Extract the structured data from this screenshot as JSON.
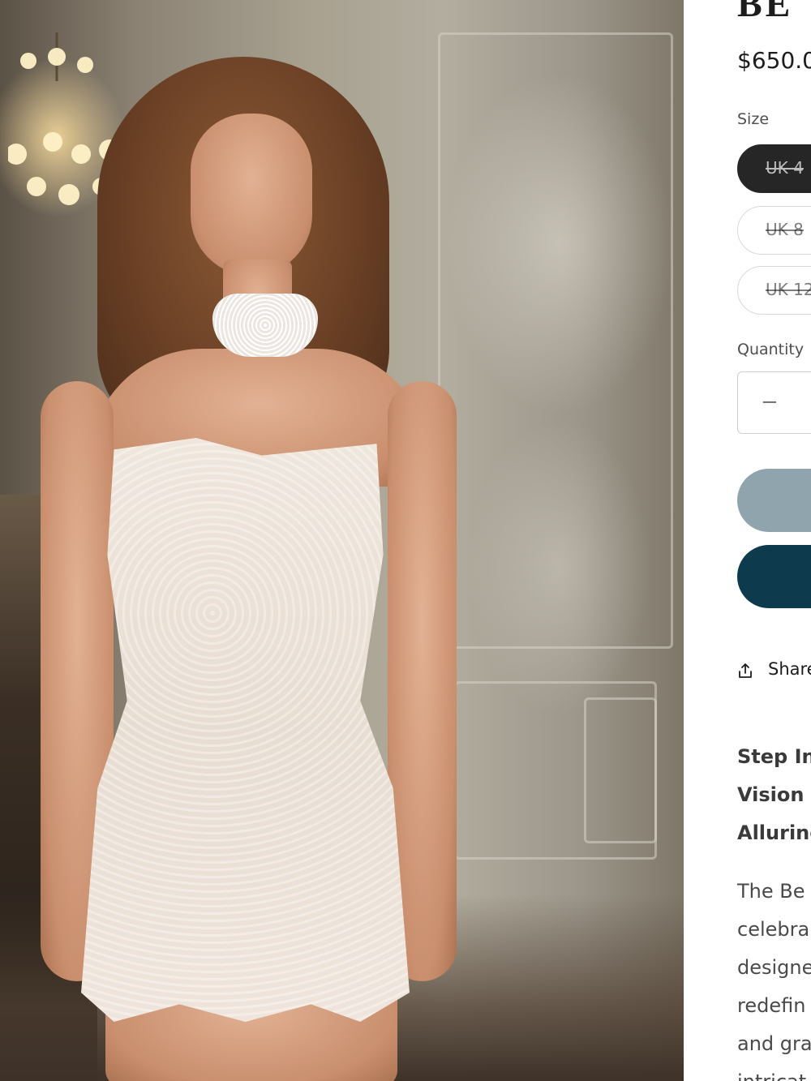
{
  "product": {
    "title": "BE",
    "price": "$650.0"
  },
  "size": {
    "label": "Size",
    "options": [
      {
        "label": "UK 4",
        "selected": true,
        "available": false
      },
      {
        "label": "UK 8",
        "selected": false,
        "available": false
      },
      {
        "label": "UK 12",
        "selected": false,
        "available": false
      }
    ]
  },
  "quantity": {
    "label": "Quantity",
    "minus_symbol": "−"
  },
  "share": {
    "label": "Share",
    "icon": "share-icon"
  },
  "description": {
    "headline": [
      "Step In",
      "Vision",
      "Alluring"
    ],
    "body": [
      "The Be",
      "celebra",
      "designe",
      "redefin",
      "and gra",
      "intricat"
    ]
  },
  "colors": {
    "primary_button": "#8fa4ad",
    "secondary_button": "#0d3b4d",
    "selected_pill": "#262626"
  }
}
